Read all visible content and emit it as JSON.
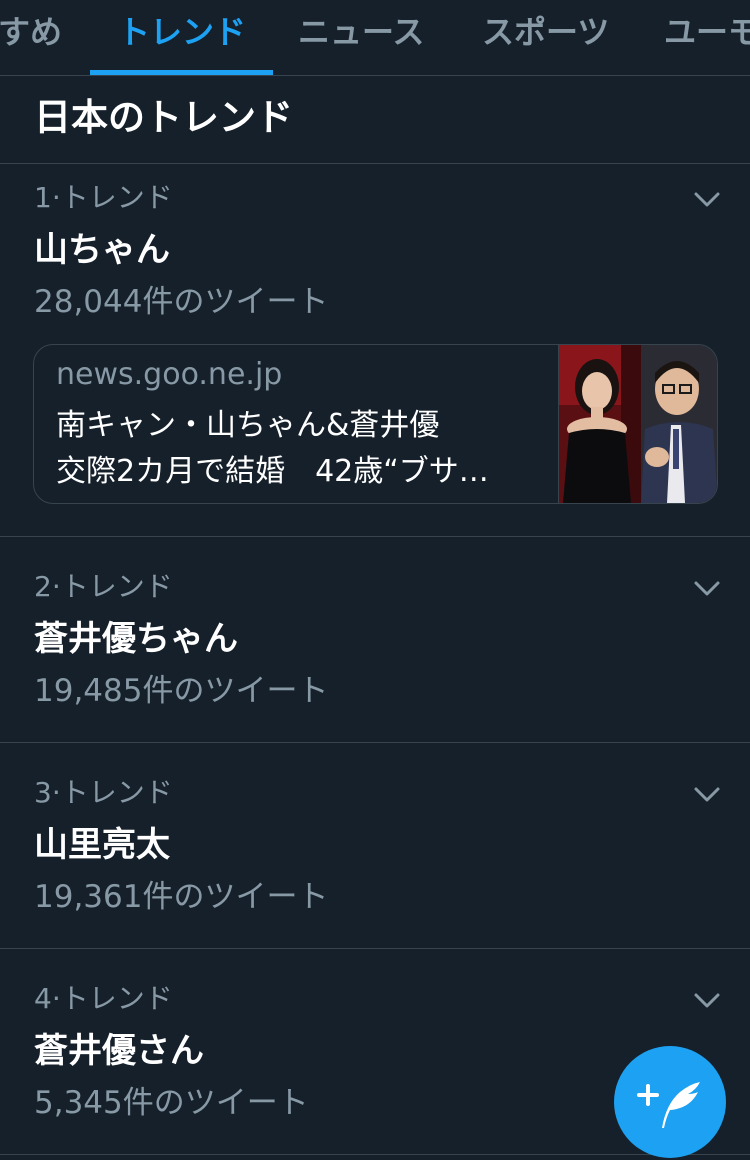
{
  "tabs": [
    {
      "label": "すめ"
    },
    {
      "label": "トレンド"
    },
    {
      "label": "ニュース"
    },
    {
      "label": "スポーツ"
    },
    {
      "label": "ユーモ"
    }
  ],
  "active_tab": "トレンド",
  "section_title": "日本のトレンド",
  "trends": [
    {
      "meta": "1·トレンド",
      "name": "山ちゃん",
      "count": "28,044件のツイート"
    },
    {
      "meta": "2·トレンド",
      "name": "蒼井優ちゃん",
      "count": "19,485件のツイート"
    },
    {
      "meta": "3·トレンド",
      "name": "山里亮太",
      "count": "19,361件のツイート"
    },
    {
      "meta": "4·トレンド",
      "name": "蒼井優さん",
      "count": "5,345件のツイート"
    }
  ],
  "news_card": {
    "domain": "news.goo.ne.jp",
    "headline_line1": "南キャン・山ちゃん&蒼井優",
    "headline_line2": "交際2カ月で結婚　42歳“ブサ…"
  },
  "icons": {
    "trend_menu": "chevron-down-icon",
    "compose": "compose-tweet-icon"
  },
  "colors": {
    "background": "#15202b",
    "accent": "#1da1f2",
    "secondary_text": "#8899a6",
    "divider": "#38444d"
  }
}
